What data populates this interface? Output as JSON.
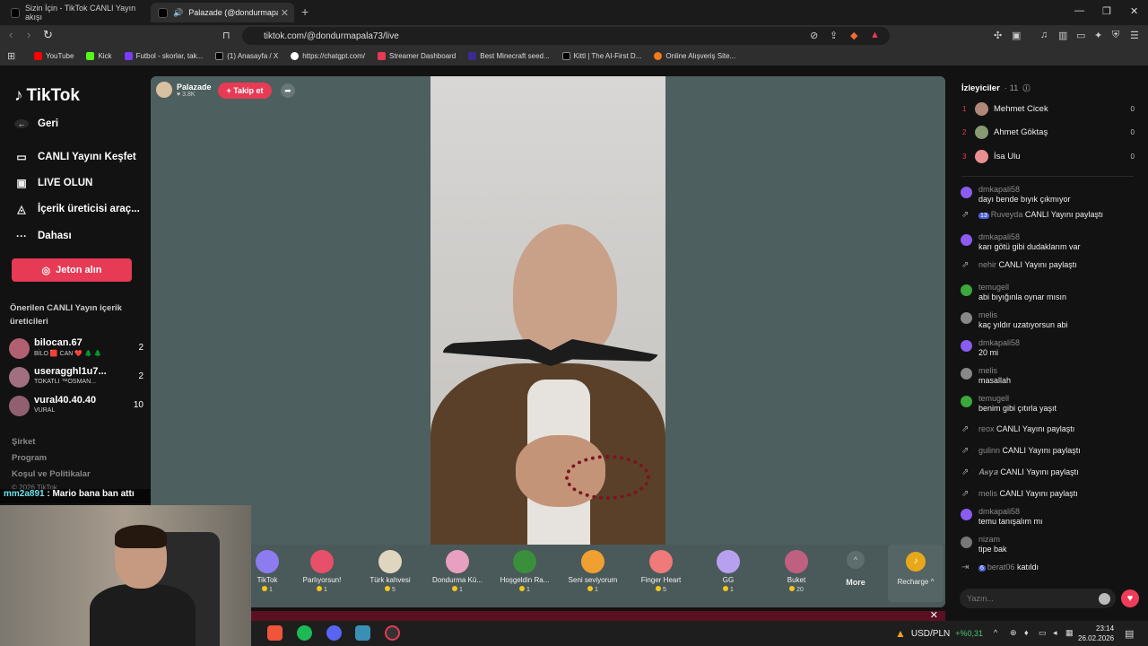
{
  "browser": {
    "tabs": [
      {
        "label": "Sizin İçin - TikTok CANLI Yayın akışı"
      },
      {
        "label": "Palazade (@dondurmapala73"
      }
    ],
    "url": "tiktok.com/@dondurmapala73/live",
    "bookmarks": [
      {
        "label": "YouTube",
        "color": "#ff0000"
      },
      {
        "label": "Kick",
        "color": "#53fc18"
      },
      {
        "label": "Futbol - skorlar, tak...",
        "color": "#7a3cff"
      },
      {
        "label": "(1) Anasayfa / X",
        "color": "#000000"
      },
      {
        "label": "https://chatgpt.com/",
        "color": "#ffffff"
      },
      {
        "label": "Streamer Dashboard",
        "color": "#e63a55"
      },
      {
        "label": "Best Minecraft seed...",
        "color": "#3b2a8f"
      },
      {
        "label": "Kittl | The AI-First D...",
        "color": "#000000"
      },
      {
        "label": "Online Alışveriş Site...",
        "color": "#f27a1a"
      }
    ]
  },
  "sidebar": {
    "logo": "TikTok",
    "back": "Geri",
    "nav": [
      {
        "label": "CANLI Yayını Keşfet"
      },
      {
        "label": "LIVE OLUN"
      },
      {
        "label": "İçerik üreticisi araç..."
      },
      {
        "label": "Dahası"
      }
    ],
    "jeton_button": "Jeton alın",
    "suggested_title": "Önerilen CANLI Yayın içerik üreticileri",
    "suggested": [
      {
        "name": "bilocan.67",
        "sub": "BİLO 🟥 CAN ❤️ 🌲 🌲",
        "count": "2"
      },
      {
        "name": "useragghl1u7...",
        "sub": "TOKATLI ™OSMAN...",
        "count": "2"
      },
      {
        "name": "vural40.40.40",
        "sub": "VURAL",
        "count": "10"
      }
    ],
    "footer": [
      "Şirket",
      "Program",
      "Koşul ve Politikalar"
    ],
    "copyright": "© 2026 TikTok"
  },
  "overlay_chat": {
    "user": "mm2a891",
    "text": " : Mario bana ban attı"
  },
  "stream": {
    "host_name": "Palazade",
    "host_likes": "♥ 3.8K",
    "follow_label": "+ Takip et",
    "gifts": [
      {
        "name": "TikTok",
        "price": "1",
        "color": "#8c7cf0"
      },
      {
        "name": "Parlıyorsun!",
        "price": "1",
        "color": "#e8506a"
      },
      {
        "name": "Türk kahvesi",
        "price": "5",
        "color": "#e0d6c0"
      },
      {
        "name": "Dondurma Kü...",
        "price": "1",
        "color": "#e8a0c0"
      },
      {
        "name": "Hoşgeldin Ra...",
        "price": "1",
        "color": "#3a8f3a"
      },
      {
        "name": "Seni seviyorum",
        "price": "1",
        "color": "#f0a030"
      },
      {
        "name": "Finger Heart",
        "price": "5",
        "color": "#f07a7a"
      },
      {
        "name": "GG",
        "price": "1",
        "color": "#b8a0f0"
      },
      {
        "name": "Buket",
        "price": "20",
        "color": "#c06080"
      }
    ],
    "more_label": "More",
    "recharge_label": "Recharge ^"
  },
  "chat": {
    "viewers_title": "İzleyiciler",
    "viewers_count": "· 11",
    "top_viewers": [
      {
        "rank": "1",
        "name": "Mehmet Cicek",
        "score": "0"
      },
      {
        "rank": "2",
        "name": "Ahmet Göktaş",
        "score": "0"
      },
      {
        "rank": "3",
        "name": "İsa Ulu",
        "score": "0"
      }
    ],
    "messages": [
      {
        "type": "msg",
        "user": "dmkapali58",
        "text": "dayı bende bıyık çıkmıyor",
        "color": "#8a5cf0"
      },
      {
        "type": "share",
        "user": "Ruveyda",
        "badge": "13",
        "text": "CANLI Yayını paylaştı"
      },
      {
        "type": "msg",
        "user": "dmkapali58",
        "text": "karı götü gibi dudaklarım var",
        "color": "#8a5cf0"
      },
      {
        "type": "share",
        "user": "nehir",
        "text": "CANLI Yayını paylaştı"
      },
      {
        "type": "msg",
        "user": "temugell",
        "text": "abi bıyığınla oynar mısın",
        "color": "#3aa83a"
      },
      {
        "type": "msg",
        "user": "melis",
        "text": "kaç yıldır uzatıyorsun abi",
        "color": "#888888"
      },
      {
        "type": "msg",
        "user": "dmkapali58",
        "text": "20 mi",
        "color": "#8a5cf0"
      },
      {
        "type": "msg",
        "user": "melis",
        "text": "masallah",
        "color": "#888888"
      },
      {
        "type": "msg",
        "user": "temugell",
        "text": "benim gibi çıtırla yaşıt",
        "color": "#3aa83a"
      },
      {
        "type": "share",
        "user": "reox",
        "text": "CANLI Yayını paylaştı"
      },
      {
        "type": "share",
        "user": "gulinn",
        "text": "CANLI Yayını paylaştı"
      },
      {
        "type": "share",
        "user": "𝑨𝒔𝒚𝒂",
        "text": "CANLI Yayını paylaştı"
      },
      {
        "type": "share",
        "user": "melis",
        "text": "CANLI Yayını paylaştı"
      },
      {
        "type": "msg",
        "user": "dmkapali58",
        "text": "temu tanışalım mı",
        "color": "#8a5cf0"
      },
      {
        "type": "msg",
        "user": "nizam",
        "text": "tipe bak",
        "color": "#777777"
      },
      {
        "type": "join",
        "user": "berat06",
        "badge": "6",
        "text": "katıldı"
      }
    ],
    "input_placeholder": "Yazın..."
  },
  "taskbar": {
    "stock_name": "USD/PLN",
    "stock_change": "+%0,31",
    "time": "23:14",
    "date": "26.02.2026"
  }
}
